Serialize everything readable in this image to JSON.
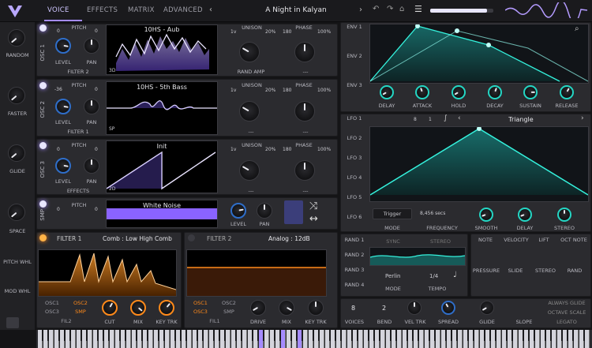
{
  "header": {
    "tabs": [
      "VOICE",
      "EFFECTS",
      "MATRIX",
      "ADVANCED"
    ],
    "active_tab": "VOICE",
    "preset_name": "A Night in Kalyan"
  },
  "macros": [
    {
      "label": "RANDOM"
    },
    {
      "label": "FASTER"
    },
    {
      "label": "GLIDE"
    },
    {
      "label": "SPACE"
    }
  ],
  "left_wheels": {
    "pitch": "PITCH WHL",
    "mod": "MOD WHL"
  },
  "oscillators": [
    {
      "name": "OSC 1",
      "pitch_label": "PITCH",
      "pitch_left": "0",
      "pitch_right": "0",
      "level": "LEVEL",
      "pan": "PAN",
      "route": "FILTER 2",
      "wavetable": "10HS - Aub",
      "dim": "3D",
      "unison_label": "UNISON",
      "unison_voices": "1v",
      "unison_amt": "20%",
      "phase_label": "PHASE",
      "phase_deg": "180",
      "phase_amt": "100%",
      "bottom_mid": "RAND AMP",
      "bottom_right": "---"
    },
    {
      "name": "OSC 2",
      "pitch_label": "PITCH",
      "pitch_left": "-36",
      "pitch_right": "0",
      "level": "LEVEL",
      "pan": "PAN",
      "route": "FILTER 1",
      "wavetable": "10HS - 5th Bass",
      "dim": "SP",
      "unison_label": "UNISON",
      "unison_voices": "1v",
      "unison_amt": "20%",
      "phase_label": "PHASE",
      "phase_deg": "180",
      "phase_amt": "100%",
      "bottom_mid": "---",
      "bottom_right": "---"
    },
    {
      "name": "OSC 3",
      "pitch_label": "PITCH",
      "pitch_left": "0",
      "pitch_right": "0",
      "level": "LEVEL",
      "pan": "PAN",
      "route": "EFFECTS",
      "wavetable": "Init",
      "dim": "2D",
      "unison_label": "UNISON",
      "unison_voices": "1v",
      "unison_amt": "20%",
      "phase_label": "PHASE",
      "phase_deg": "180",
      "phase_amt": "100%",
      "bottom_mid": "---",
      "bottom_right": "---"
    }
  ],
  "smp": {
    "name": "SMP",
    "pitch_label": "PITCH",
    "pitch_left": "0",
    "pitch_right": "0",
    "sample": "White Noise",
    "level": "LEVEL",
    "pan": "PAN"
  },
  "filter1": {
    "title": "FILTER 1",
    "type": "Comb : Low High Comb",
    "osc": [
      "OSC1",
      "OSC2",
      "OSC3",
      "SMP",
      "FIL2"
    ],
    "knobs": [
      "CUT",
      "MIX",
      "KEY TRK"
    ]
  },
  "filter2": {
    "title": "FILTER 2",
    "type": "Analog : 12dB",
    "osc": [
      "OSC1",
      "OSC2",
      "OSC3",
      "SMP",
      "FIL1"
    ],
    "knobs": [
      "DRIVE",
      "MIX",
      "KEY TRK"
    ]
  },
  "envelopes": {
    "tabs": [
      "ENV 1",
      "ENV 2",
      "ENV 3"
    ],
    "knobs": [
      "DELAY",
      "ATTACK",
      "HOLD",
      "DECAY",
      "SUSTAIN",
      "RELEASE"
    ]
  },
  "lfos": {
    "tabs": [
      "LFO 1",
      "LFO 2",
      "LFO 3",
      "LFO 4",
      "LFO 5",
      "LFO 6"
    ],
    "shape": "Triangle",
    "num_a": "8",
    "num_b": "1",
    "trigger": "Trigger",
    "freq_value": "8,456 secs",
    "labels": [
      "MODE",
      "FREQUENCY",
      "SMOOTH",
      "DELAY",
      "STEREO"
    ]
  },
  "randoms": {
    "tabs": [
      "RAND 1",
      "RAND 2",
      "RAND 3",
      "RAND 4"
    ],
    "sync": "SYNC",
    "stereo": "STEREO",
    "mode_value": "Perlin",
    "tempo_value": "1/4",
    "mode_label": "MODE",
    "tempo_label": "TEMPO"
  },
  "voice": {
    "note": "NOTE",
    "velocity": "VELOCITY",
    "lift": "LIFT",
    "oct_note": "OCT NOTE",
    "pressure": "PRESSURE",
    "slide": "SLIDE",
    "stereo": "STEREO",
    "rand": "RAND",
    "voices_value": "8",
    "bend_value": "2",
    "voices": "VOICES",
    "bend": "BEND",
    "vel_trk": "VEL TRK",
    "spread": "SPREAD",
    "glide": "GLIDE",
    "slope": "SLOPE",
    "always_glide": "ALWAYS GLIDE",
    "octave_scale": "OCTAVE SCALE",
    "legato": "LEGATO"
  },
  "colors": {
    "accent": "#a58bff",
    "teal": "#24d6c4",
    "orange": "#ff8a1a",
    "blue": "#2f6ec9"
  }
}
